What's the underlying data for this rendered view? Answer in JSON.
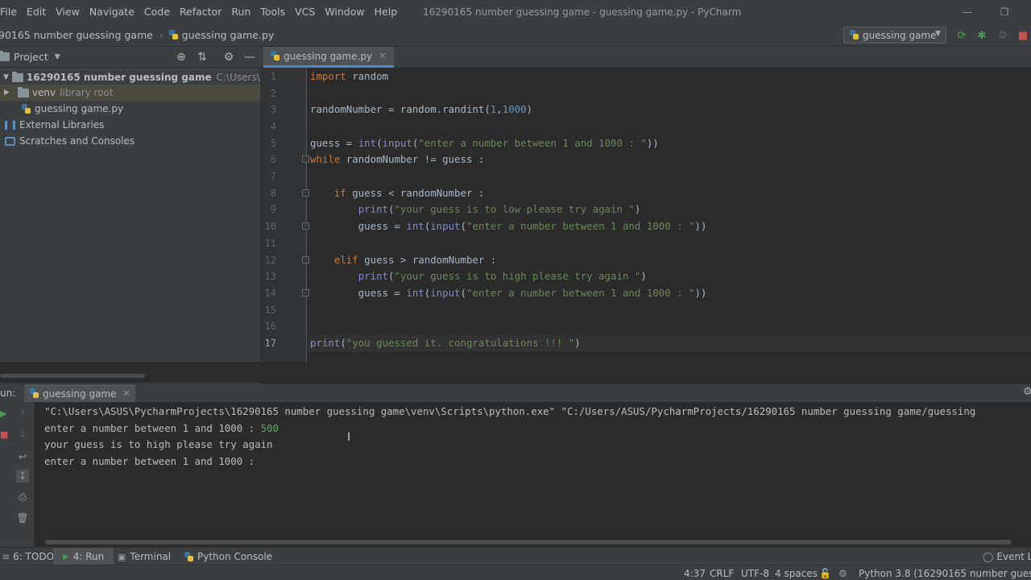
{
  "menu": [
    "File",
    "Edit",
    "View",
    "Navigate",
    "Code",
    "Refactor",
    "Run",
    "Tools",
    "VCS",
    "Window",
    "Help"
  ],
  "window_title": "16290165 number guessing game - guessing game.py - PyCharm",
  "breadcrumb": {
    "project": "90165 number guessing game",
    "file": "guessing game.py"
  },
  "run_config": "guessing game",
  "project_panel": {
    "title": "Project",
    "root_name": "16290165 number guessing game",
    "root_path": "C:\\Users\\ASUS\\Pych",
    "venv": "venv",
    "venv_hint": "library root",
    "file": "guessing game.py",
    "external": "External Libraries",
    "scratches": "Scratches and Consoles"
  },
  "editor": {
    "tab": "guessing game.py",
    "line_numbers": [
      "1",
      "2",
      "3",
      "4",
      "5",
      "6",
      "7",
      "8",
      "9",
      "10",
      "11",
      "12",
      "13",
      "14",
      "15",
      "16",
      "17"
    ]
  },
  "run_panel": {
    "label": "un:",
    "tab": "guessing game",
    "console": {
      "cmd": "\"C:\\Users\\ASUS\\PycharmProjects\\16290165 number guessing game\\venv\\Scripts\\python.exe\" \"C:/Users/ASUS/PycharmProjects/16290165 number guessing game/guessing",
      "prompt1": "enter a number between 1 and 1000 : ",
      "input1": "500",
      "out1": "your guess is to high please try again",
      "prompt2": "enter a number between 1 and 1000 :"
    }
  },
  "tool_windows": {
    "todo": "6: TODO",
    "run": "4: Run",
    "terminal": "Terminal",
    "python_console": "Python Console",
    "event_log": "Event Lo"
  },
  "status": {
    "position": "4:37",
    "line_sep": "CRLF",
    "encoding": "UTF-8",
    "indent": "4 spaces",
    "interpreter": "Python 3.8 (16290165 number guessing g"
  },
  "colors": {
    "keyword": "#cc7832",
    "string": "#6a8759",
    "builtin": "#8888c6",
    "number": "#6897bb",
    "run_green": "#499c54"
  }
}
